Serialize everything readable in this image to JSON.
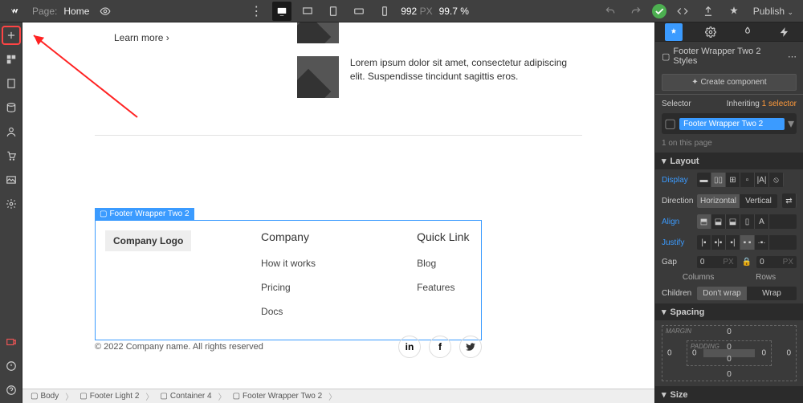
{
  "toolbar": {
    "page_label": "Page:",
    "page_name": "Home",
    "width_px": "992",
    "px_label": "PX",
    "zoom": "99.7 %",
    "publish": "Publish"
  },
  "canvas": {
    "learn_more": "Learn more",
    "lorem1": "Lorem ipsum dolor sit amet, consectetur adipiscing elit. Suspendisse tincidunt sagittis eros.",
    "selection_label": "Footer Wrapper Two 2",
    "company_logo": "Company Logo",
    "cols": [
      {
        "head": "Company",
        "links": [
          "How it works",
          "Pricing",
          "Docs"
        ]
      },
      {
        "head": "Quick Link",
        "links": [
          "Blog",
          "Features"
        ]
      }
    ],
    "copyright": "© 2022 Company name. All rights reserved"
  },
  "crumbs": [
    "Body",
    "Footer Light 2",
    "Container 4",
    "Footer Wrapper Two 2"
  ],
  "panel": {
    "styles_title": "Footer Wrapper Two 2 Styles",
    "create_component": "Create component",
    "selector_label": "Selector",
    "inheriting": "Inheriting",
    "inheriting_count": "1 selector",
    "selector_tag": "Footer Wrapper Two 2",
    "count": "1 on this page",
    "layout": "Layout",
    "display": "Display",
    "direction": "Direction",
    "horizontal": "Horizontal",
    "vertical": "Vertical",
    "align": "Align",
    "justify": "Justify",
    "gap": "Gap",
    "gap_val": "0",
    "gap_unit": "PX",
    "columns": "Columns",
    "rows": "Rows",
    "children": "Children",
    "dont_wrap": "Don't wrap",
    "wrap": "Wrap",
    "spacing": "Spacing",
    "margin": "MARGIN",
    "padding": "PADDING",
    "val0": "0",
    "size": "Size"
  }
}
